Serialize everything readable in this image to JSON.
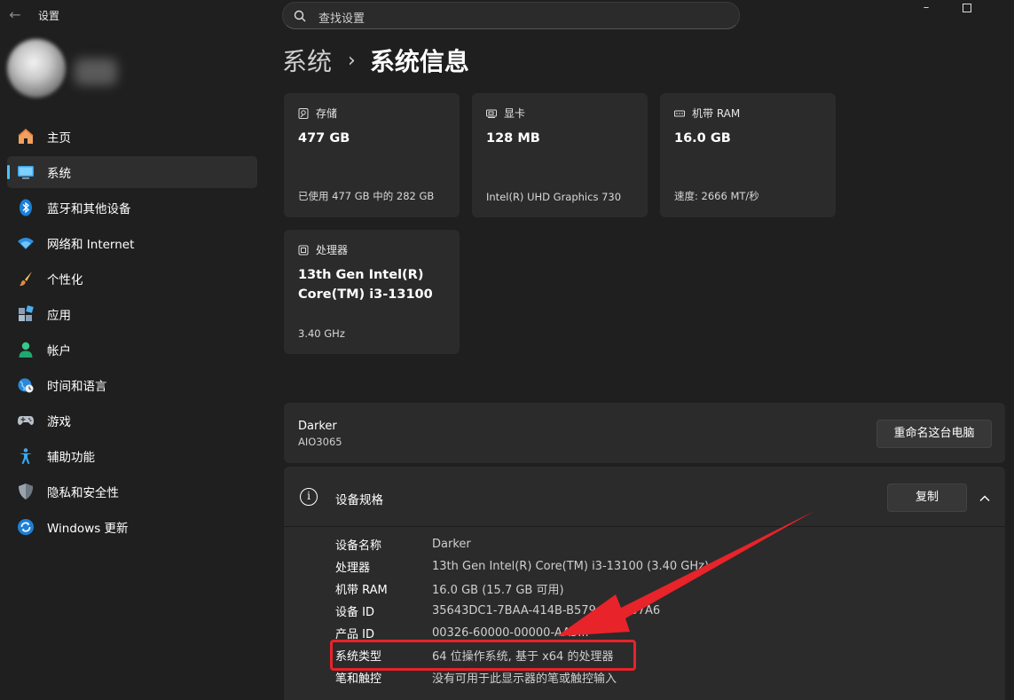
{
  "window": {
    "title": "设置",
    "minimize": "–"
  },
  "search": {
    "placeholder": "查找设置"
  },
  "sidebar": {
    "items": [
      {
        "label": "主页",
        "icon": "home-icon"
      },
      {
        "label": "系统",
        "icon": "monitor-icon",
        "active": true
      },
      {
        "label": "蓝牙和其他设备",
        "icon": "bluetooth-icon"
      },
      {
        "label": "网络和 Internet",
        "icon": "wifi-icon"
      },
      {
        "label": "个性化",
        "icon": "brush-icon"
      },
      {
        "label": "应用",
        "icon": "apps-icon"
      },
      {
        "label": "帐户",
        "icon": "person-icon"
      },
      {
        "label": "时间和语言",
        "icon": "globe-clock-icon"
      },
      {
        "label": "游戏",
        "icon": "gamepad-icon"
      },
      {
        "label": "辅助功能",
        "icon": "accessibility-icon"
      },
      {
        "label": "隐私和安全性",
        "icon": "shield-icon"
      },
      {
        "label": "Windows 更新",
        "icon": "update-icon"
      }
    ]
  },
  "breadcrumb": {
    "parent": "系统",
    "separator": "›",
    "current": "系统信息"
  },
  "cards": [
    {
      "title": "存储",
      "value": "477 GB",
      "sub": "已使用 477 GB 中的 282 GB",
      "icon": "storage-icon"
    },
    {
      "title": "显卡",
      "value": "128 MB",
      "sub": "Intel(R) UHD Graphics 730",
      "icon": "gpu-icon"
    },
    {
      "title": "机带 RAM",
      "value": "16.0 GB",
      "sub": "速度: 2666 MT/秒",
      "icon": "ram-icon"
    },
    {
      "title": "处理器",
      "value": "13th Gen Intel(R) Core(TM) i3-13100",
      "sub": "3.40 GHz",
      "icon": "cpu-icon"
    }
  ],
  "device": {
    "name": "Darker",
    "model": "AIO3065",
    "rename_label": "重命名这台电脑"
  },
  "specs": {
    "title": "设备规格",
    "copy_label": "复制",
    "rows": [
      {
        "label": "设备名称",
        "value": "Darker"
      },
      {
        "label": "处理器",
        "value": "13th Gen Intel(R) Core(TM) i3-13100 (3.40 GHz)"
      },
      {
        "label": "机带 RAM",
        "value": "16.0 GB (15.7 GB 可用)"
      },
      {
        "label": "设备 ID",
        "value": "35643DC1-7BAA-414B-B579-...-A607A6"
      },
      {
        "label": "产品 ID",
        "value": "00326-60000-00000-AA5..."
      },
      {
        "label": "系统类型",
        "value": "64 位操作系统, 基于 x64 的处理器"
      },
      {
        "label": "笔和触控",
        "value": "没有可用于此显示器的笔或触控输入"
      }
    ]
  },
  "colors": {
    "accent": "#4cc2ff",
    "annotation": "#e8232a",
    "background": "#1f1f1f",
    "card": "#2b2b2b"
  }
}
